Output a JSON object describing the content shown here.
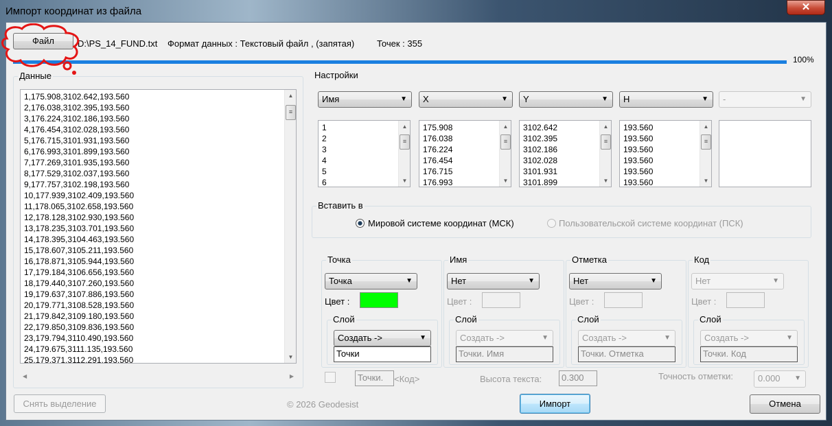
{
  "window": {
    "title": "Импорт координат из файла",
    "close": "✕"
  },
  "header": {
    "file_button": "Файл",
    "file_name": "D:\\PS_14_FUND.txt",
    "format": "Формат данных : Текстовый файл , (запятая)",
    "points": "Точек : 355",
    "progress_percent": 100,
    "progress_label": "100%",
    "progress_color": "#1a7fe0"
  },
  "data_panel": {
    "title": "Данные",
    "rows": [
      "1,175.908,3102.642,193.560",
      "2,176.038,3102.395,193.560",
      "3,176.224,3102.186,193.560",
      "4,176.454,3102.028,193.560",
      "5,176.715,3101.931,193.560",
      "6,176.993,3101.899,193.560",
      "7,177.269,3101.935,193.560",
      "8,177.529,3102.037,193.560",
      "9,177.757,3102.198,193.560",
      "10,177.939,3102.409,193.560",
      "11,178.065,3102.658,193.560",
      "12,178.128,3102.930,193.560",
      "13,178.235,3103.701,193.560",
      "14,178.395,3104.463,193.560",
      "15,178.607,3105.211,193.560",
      "16,178.871,3105.944,193.560",
      "17,179.184,3106.656,193.560",
      "18,179.440,3107.260,193.560",
      "19,179.637,3107.886,193.560",
      "20,179.771,3108.528,193.560",
      "21,179.842,3109.180,193.560",
      "22,179.850,3109.836,193.560",
      "23,179.794,3110.490,193.560",
      "24,179.675,3111.135,193.560",
      "25,179.371,3112.291,193.560"
    ]
  },
  "settings": {
    "title": "Настройки",
    "columns": [
      {
        "select": "Имя",
        "values": [
          "1",
          "2",
          "3",
          "4",
          "5",
          "6"
        ]
      },
      {
        "select": "X",
        "values": [
          "175.908",
          "176.038",
          "176.224",
          "176.454",
          "176.715",
          "176.993"
        ]
      },
      {
        "select": "Y",
        "values": [
          "3102.642",
          "3102.395",
          "3102.186",
          "3102.028",
          "3101.931",
          "3101.899"
        ]
      },
      {
        "select": "H",
        "values": [
          "193.560",
          "193.560",
          "193.560",
          "193.560",
          "193.560",
          "193.560"
        ]
      },
      {
        "select": "-",
        "values": []
      }
    ],
    "insert_title": "Вставить в",
    "radio_wcs": "Мировой системе координат (МСК)",
    "radio_ucs": "Пользовательской системе координат (ПСК)",
    "selected": "wcs"
  },
  "groups": [
    {
      "title": "Точка",
      "select": "Точка",
      "color_label": "Цвет :",
      "color": "#00ff00",
      "layer_title": "Слой",
      "layer_select": "Создать ->",
      "layer_name": "Точки"
    },
    {
      "title": "Имя",
      "select": "Нет",
      "color_label": "Цвет :",
      "layer_title": "Слой",
      "layer_select": "Создать ->",
      "layer_name": "Точки. Имя"
    },
    {
      "title": "Отметка",
      "select": "Нет",
      "color_label": "Цвет :",
      "layer_title": "Слой",
      "layer_select": "Создать ->",
      "layer_name": "Точки. Отметка"
    },
    {
      "title": "Код",
      "select": "Нет",
      "color_label": "Цвет :",
      "layer_title": "Слой",
      "layer_select": "Создать ->",
      "layer_name": "Точки. Код"
    }
  ],
  "options": {
    "prefix": "Точки.",
    "code_label": "<Код>",
    "text_height_label": "Высота текста:",
    "text_height": "0.300",
    "precision_label": "Точность отметки:",
    "precision": "0.000"
  },
  "footer": {
    "deselect": "Снять выделение",
    "copyright": "© 2026 Geodesist",
    "import": "Импорт",
    "cancel": "Отмена"
  }
}
